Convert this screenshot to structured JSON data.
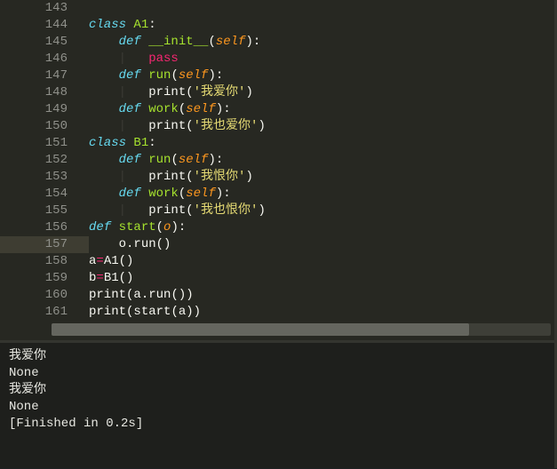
{
  "editor": {
    "active_line": 157,
    "lines": [
      {
        "num": 143,
        "tokens": []
      },
      {
        "num": 144,
        "tokens": [
          {
            "t": "class ",
            "c": "kw"
          },
          {
            "t": "A1",
            "c": "fn"
          },
          {
            "t": ":",
            "c": "pun"
          }
        ]
      },
      {
        "num": 145,
        "tokens": [
          {
            "t": "    ",
            "c": "white"
          },
          {
            "t": "def ",
            "c": "kw"
          },
          {
            "t": "__init__",
            "c": "fn"
          },
          {
            "t": "(",
            "c": "pun"
          },
          {
            "t": "self",
            "c": "par"
          },
          {
            "t": ")",
            "c": "pun"
          },
          {
            "t": ":",
            "c": "pun"
          }
        ]
      },
      {
        "num": 146,
        "tokens": [
          {
            "t": "    ",
            "c": "white"
          },
          {
            "t": "|   ",
            "c": "guide"
          },
          {
            "t": "pass",
            "c": "kw2"
          }
        ]
      },
      {
        "num": 147,
        "tokens": [
          {
            "t": "    ",
            "c": "white"
          },
          {
            "t": "def ",
            "c": "kw"
          },
          {
            "t": "run",
            "c": "fn"
          },
          {
            "t": "(",
            "c": "pun"
          },
          {
            "t": "self",
            "c": "par"
          },
          {
            "t": ")",
            "c": "pun"
          },
          {
            "t": ":",
            "c": "pun"
          }
        ]
      },
      {
        "num": 148,
        "tokens": [
          {
            "t": "    ",
            "c": "white"
          },
          {
            "t": "|   ",
            "c": "guide"
          },
          {
            "t": "print",
            "c": "white"
          },
          {
            "t": "(",
            "c": "pun"
          },
          {
            "t": "'我爱你'",
            "c": "str"
          },
          {
            "t": ")",
            "c": "pun"
          }
        ]
      },
      {
        "num": 149,
        "tokens": [
          {
            "t": "    ",
            "c": "white"
          },
          {
            "t": "def ",
            "c": "kw"
          },
          {
            "t": "work",
            "c": "fn"
          },
          {
            "t": "(",
            "c": "pun"
          },
          {
            "t": "self",
            "c": "par"
          },
          {
            "t": ")",
            "c": "pun"
          },
          {
            "t": ":",
            "c": "pun"
          }
        ]
      },
      {
        "num": 150,
        "tokens": [
          {
            "t": "    ",
            "c": "white"
          },
          {
            "t": "|   ",
            "c": "guide"
          },
          {
            "t": "print",
            "c": "white"
          },
          {
            "t": "(",
            "c": "pun"
          },
          {
            "t": "'我也爱你'",
            "c": "str"
          },
          {
            "t": ")",
            "c": "pun"
          }
        ]
      },
      {
        "num": 151,
        "tokens": [
          {
            "t": "class ",
            "c": "kw"
          },
          {
            "t": "B1",
            "c": "fn"
          },
          {
            "t": ":",
            "c": "pun"
          }
        ]
      },
      {
        "num": 152,
        "tokens": [
          {
            "t": "    ",
            "c": "white"
          },
          {
            "t": "def ",
            "c": "kw"
          },
          {
            "t": "run",
            "c": "fn"
          },
          {
            "t": "(",
            "c": "pun"
          },
          {
            "t": "self",
            "c": "par"
          },
          {
            "t": ")",
            "c": "pun"
          },
          {
            "t": ":",
            "c": "pun"
          }
        ]
      },
      {
        "num": 153,
        "tokens": [
          {
            "t": "    ",
            "c": "white"
          },
          {
            "t": "|   ",
            "c": "guide"
          },
          {
            "t": "print",
            "c": "white"
          },
          {
            "t": "(",
            "c": "pun"
          },
          {
            "t": "'我恨你'",
            "c": "str"
          },
          {
            "t": ")",
            "c": "pun"
          }
        ]
      },
      {
        "num": 154,
        "tokens": [
          {
            "t": "    ",
            "c": "white"
          },
          {
            "t": "def ",
            "c": "kw"
          },
          {
            "t": "work",
            "c": "fn"
          },
          {
            "t": "(",
            "c": "pun"
          },
          {
            "t": "self",
            "c": "par"
          },
          {
            "t": ")",
            "c": "pun"
          },
          {
            "t": ":",
            "c": "pun"
          }
        ]
      },
      {
        "num": 155,
        "tokens": [
          {
            "t": "    ",
            "c": "white"
          },
          {
            "t": "|   ",
            "c": "guide"
          },
          {
            "t": "print",
            "c": "white"
          },
          {
            "t": "(",
            "c": "pun"
          },
          {
            "t": "'我也恨你'",
            "c": "str"
          },
          {
            "t": ")",
            "c": "pun"
          }
        ]
      },
      {
        "num": 156,
        "tokens": [
          {
            "t": "def ",
            "c": "kw"
          },
          {
            "t": "start",
            "c": "fn"
          },
          {
            "t": "(",
            "c": "pun"
          },
          {
            "t": "o",
            "c": "par"
          },
          {
            "t": ")",
            "c": "pun"
          },
          {
            "t": ":",
            "c": "pun"
          }
        ]
      },
      {
        "num": 157,
        "tokens": [
          {
            "t": "    ",
            "c": "white"
          },
          {
            "t": "o",
            "c": "white"
          },
          {
            "t": ".",
            "c": "pun"
          },
          {
            "t": "run",
            "c": "white"
          },
          {
            "t": "(",
            "c": "pun"
          },
          {
            "t": ")",
            "c": "pun"
          }
        ]
      },
      {
        "num": 158,
        "tokens": [
          {
            "t": "a",
            "c": "white"
          },
          {
            "t": "=",
            "c": "op"
          },
          {
            "t": "A1",
            "c": "white"
          },
          {
            "t": "(",
            "c": "pun"
          },
          {
            "t": ")",
            "c": "pun"
          }
        ]
      },
      {
        "num": 159,
        "tokens": [
          {
            "t": "b",
            "c": "white"
          },
          {
            "t": "=",
            "c": "op"
          },
          {
            "t": "B1",
            "c": "white"
          },
          {
            "t": "(",
            "c": "pun"
          },
          {
            "t": ")",
            "c": "pun"
          }
        ]
      },
      {
        "num": 160,
        "tokens": [
          {
            "t": "print",
            "c": "white"
          },
          {
            "t": "(",
            "c": "pun"
          },
          {
            "t": "a",
            "c": "white"
          },
          {
            "t": ".",
            "c": "pun"
          },
          {
            "t": "run",
            "c": "white"
          },
          {
            "t": "(",
            "c": "pun"
          },
          {
            "t": ")",
            "c": "pun"
          },
          {
            "t": ")",
            "c": "pun"
          }
        ]
      },
      {
        "num": 161,
        "tokens": [
          {
            "t": "print",
            "c": "white"
          },
          {
            "t": "(",
            "c": "pun"
          },
          {
            "t": "start",
            "c": "white"
          },
          {
            "t": "(",
            "c": "pun"
          },
          {
            "t": "a",
            "c": "white"
          },
          {
            "t": ")",
            "c": "pun"
          },
          {
            "t": ")",
            "c": "pun"
          }
        ]
      }
    ]
  },
  "output": {
    "lines": [
      "我爱你",
      "None",
      "我爱你",
      "None",
      "[Finished in 0.2s]"
    ]
  }
}
